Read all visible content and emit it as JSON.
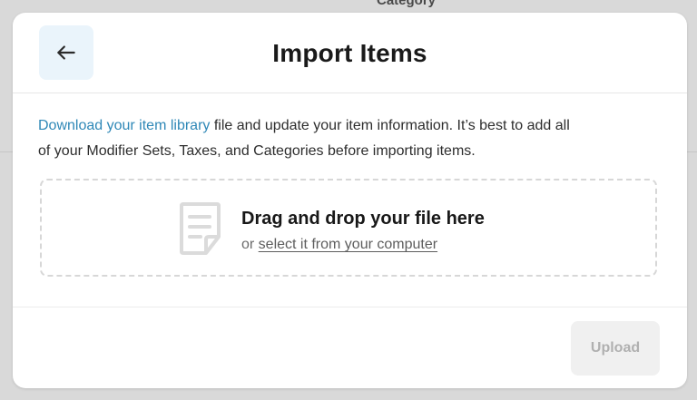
{
  "background": {
    "header_label": "Category"
  },
  "modal": {
    "title": "Import Items",
    "back_icon": "arrow-left-icon",
    "description_link": "Download your item library",
    "description_text_line1": " file and update your item information. It’s best to add all",
    "description_text_line2": "of your Modifier Sets, Taxes, and Categories before importing items.",
    "dropzone": {
      "icon": "file-document-icon",
      "title": "Drag and drop your file here",
      "prefix": "or ",
      "link": "select it from your computer"
    },
    "upload_label": "Upload"
  },
  "colors": {
    "accent": "#2f88b7",
    "back_button_bg": "#eaf4fb",
    "disabled_button_bg": "#f0f0f0",
    "disabled_button_text": "#b0b0b0"
  }
}
